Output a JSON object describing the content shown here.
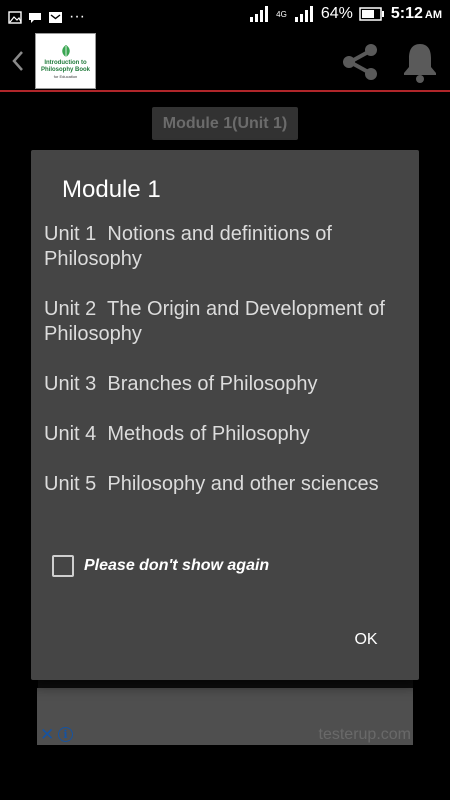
{
  "status_bar": {
    "left_icons": [
      "image-icon",
      "chat-icon",
      "mail-icon",
      "more-icon"
    ],
    "more_text": "···",
    "network_label": "4G",
    "battery_percent": "64%",
    "time": "5:12",
    "ampm": "AM"
  },
  "app_bar": {
    "logo_title": "Introduction to Philosophy Book",
    "logo_subtitle": "for Education",
    "accent_color": "#b0262a"
  },
  "module_chip": "Module 1(Unit 1)",
  "dialog": {
    "title": "Module 1",
    "units": [
      {
        "number": "Unit 1",
        "title": "Notions and definitions of Philosophy"
      },
      {
        "number": "Unit 2",
        "title": "The Origin and Development of Philosophy"
      },
      {
        "number": "Unit 3",
        "title": "Branches of Philosophy"
      },
      {
        "number": "Unit 4",
        "title": "Methods of Philosophy"
      },
      {
        "number": "Unit 5",
        "title": "Philosophy and other sciences"
      }
    ],
    "checkbox_label": "Please don't show again",
    "checkbox_checked": false,
    "ok_label": "OK"
  },
  "ad_banner": {
    "close_glyph": "✕",
    "info_glyph": "i",
    "watermark": "testerup.com"
  }
}
